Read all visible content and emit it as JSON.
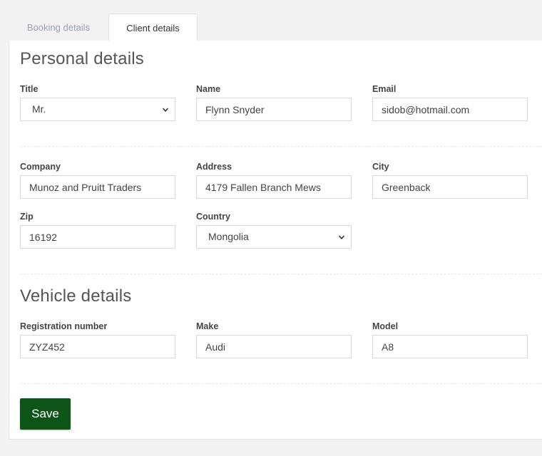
{
  "tabs": [
    {
      "label": "Booking details",
      "active": false
    },
    {
      "label": "Client details",
      "active": true
    }
  ],
  "personal": {
    "title": "Personal details",
    "title_field": {
      "label": "Title",
      "value": "Mr."
    },
    "name": {
      "label": "Name",
      "value": "Flynn Snyder"
    },
    "email": {
      "label": "Email",
      "value": "sidob@hotmail.com"
    },
    "company": {
      "label": "Company",
      "value": "Munoz and Pruitt Traders"
    },
    "address": {
      "label": "Address",
      "value": "4179 Fallen Branch Mews"
    },
    "city": {
      "label": "City",
      "value": "Greenback"
    },
    "zip": {
      "label": "Zip",
      "value": "16192"
    },
    "country": {
      "label": "Country",
      "value": "Mongolia"
    }
  },
  "vehicle": {
    "title": "Vehicle details",
    "registration": {
      "label": "Registration number",
      "value": "ZYZ452"
    },
    "make": {
      "label": "Make",
      "value": "Audi"
    },
    "model": {
      "label": "Model",
      "value": "A8"
    }
  },
  "actions": {
    "save_label": "Save"
  },
  "colors": {
    "save_button": "#0d5417",
    "inactive_tab": "#9aa2b1",
    "background": "#f3f3f3"
  }
}
